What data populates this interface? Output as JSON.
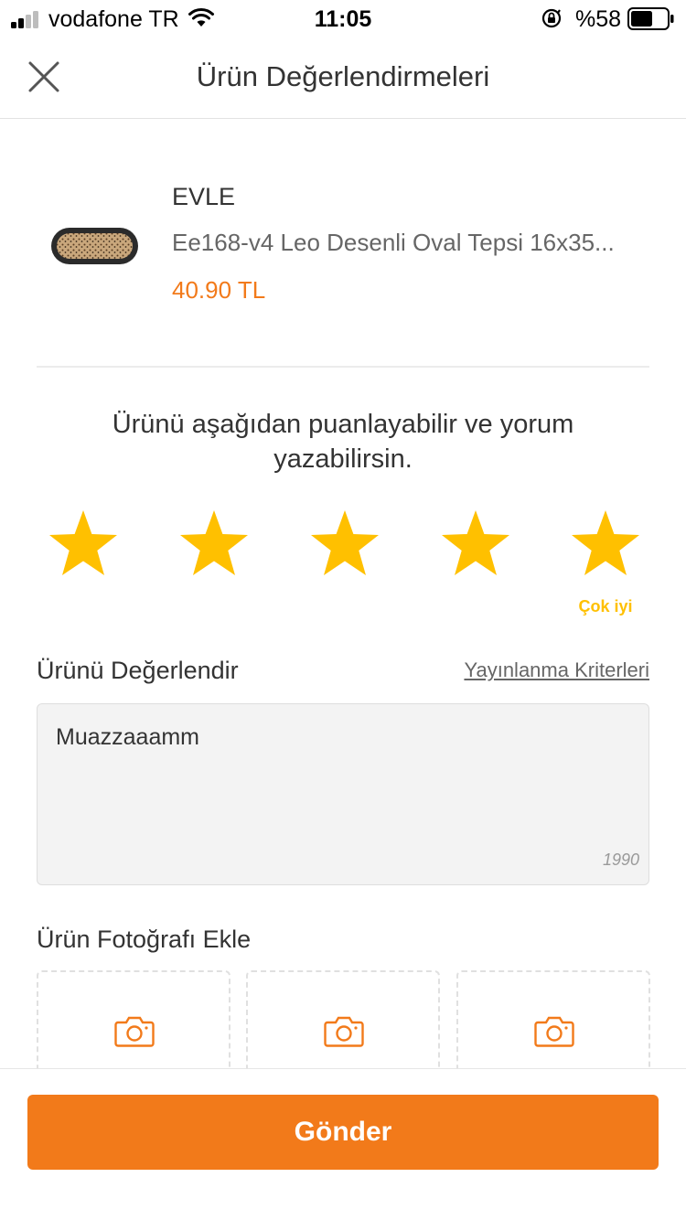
{
  "status_bar": {
    "carrier": "vodafone TR",
    "time": "11:05",
    "battery": "%58",
    "battery_level": 0.58
  },
  "header": {
    "title": "Ürün Değerlendirmeleri",
    "close_icon": "close-icon"
  },
  "product": {
    "brand": "EVLE",
    "name": "Ee168-v4 Leo Desenli Oval Tepsi 16x35...",
    "price": "40.90 TL"
  },
  "rating": {
    "prompt_line1": "Ürünü aşağıdan puanlayabilir ve yorum",
    "prompt_line2": "yazabilirsin.",
    "stars_total": 5,
    "stars_selected": 5,
    "selected_label": "Çok iyi",
    "star_color": "#ffc000"
  },
  "review": {
    "heading": "Ürünü Değerlendir",
    "criteria_link": "Yayınlanma Kriterleri",
    "text": "Muazzaaamm",
    "char_count": "1990"
  },
  "photos": {
    "heading": "Ürün Fotoğrafı Ekle",
    "slots": 3,
    "icon": "camera-icon"
  },
  "footer": {
    "submit_label": "Gönder"
  },
  "colors": {
    "accent": "#f27a1a",
    "star": "#ffc000",
    "text": "#333333"
  }
}
